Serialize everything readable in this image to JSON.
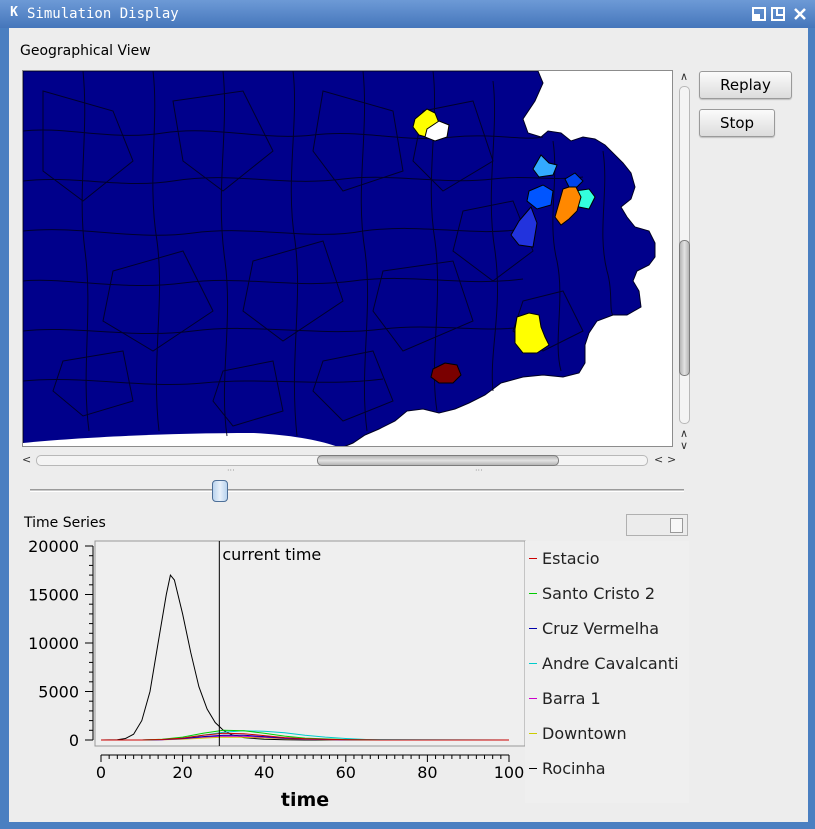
{
  "window": {
    "title": "Simulation Display"
  },
  "geo": {
    "label": "Geographical View",
    "ocean_color": "#ffffff",
    "land_color": "#00008b",
    "highlight_colors": [
      "#ffff00",
      "#ffff00",
      "#33aaff",
      "#0055ff",
      "#2233dd",
      "#33ffdd",
      "#ff8800",
      "#7a0000",
      "#ffffff"
    ]
  },
  "buttons": {
    "replay": "Replay",
    "stop": "Stop"
  },
  "timeline": {
    "value_fraction": 0.28
  },
  "timeseries": {
    "label": "Time Series",
    "marker_label": "current time"
  },
  "chart_data": {
    "type": "line",
    "xlabel": "time",
    "ylabel": "",
    "xlim": [
      0,
      100
    ],
    "ylim": [
      0,
      20000
    ],
    "x_ticks": [
      "0",
      "20",
      "40",
      "60",
      "80",
      "100"
    ],
    "y_ticks": [
      "0",
      "5000",
      "10000",
      "15000",
      "20000"
    ],
    "current_time": 29,
    "legend_placement": "right",
    "series": [
      {
        "name": "Estacio",
        "color": "#cc0000",
        "x": [
          0,
          10,
          15,
          20,
          25,
          30,
          35,
          40,
          45,
          50,
          60,
          70,
          100
        ],
        "y": [
          0,
          0,
          50,
          200,
          500,
          700,
          650,
          450,
          250,
          120,
          20,
          0,
          0
        ]
      },
      {
        "name": "Santo Cristo 2",
        "color": "#00cc00",
        "x": [
          0,
          10,
          15,
          20,
          25,
          30,
          35,
          40,
          45,
          50,
          60,
          70,
          100
        ],
        "y": [
          0,
          0,
          80,
          300,
          700,
          1000,
          950,
          700,
          400,
          200,
          40,
          0,
          0
        ]
      },
      {
        "name": "Cruz Vermelha",
        "color": "#0000aa",
        "x": [
          0,
          10,
          15,
          20,
          25,
          30,
          35,
          40,
          45,
          50,
          60,
          70,
          100
        ],
        "y": [
          0,
          0,
          40,
          150,
          350,
          500,
          480,
          350,
          200,
          100,
          20,
          0,
          0
        ]
      },
      {
        "name": "Andre Cavalcanti",
        "color": "#00cccc",
        "x": [
          0,
          10,
          15,
          20,
          25,
          30,
          35,
          40,
          45,
          50,
          55,
          60,
          65,
          100
        ],
        "y": [
          0,
          0,
          50,
          200,
          500,
          800,
          950,
          900,
          750,
          500,
          300,
          150,
          50,
          0
        ]
      },
      {
        "name": "Barra 1",
        "color": "#cc00cc",
        "x": [
          0,
          10,
          15,
          20,
          25,
          30,
          35,
          40,
          45,
          50,
          60,
          70,
          100
        ],
        "y": [
          0,
          0,
          30,
          120,
          300,
          400,
          380,
          280,
          160,
          80,
          15,
          0,
          0
        ]
      },
      {
        "name": "Downtown",
        "color": "#cccc00",
        "x": [
          0,
          10,
          15,
          20,
          25,
          30,
          35,
          40,
          45,
          50,
          60,
          70,
          100
        ],
        "y": [
          0,
          0,
          20,
          80,
          200,
          300,
          290,
          220,
          130,
          60,
          10,
          0,
          0
        ]
      },
      {
        "name": "Rocinha",
        "color": "#000000",
        "x": [
          0,
          4,
          6,
          8,
          10,
          12,
          14,
          16,
          17,
          18,
          20,
          22,
          24,
          26,
          28,
          30,
          32,
          35,
          40,
          45,
          50,
          60,
          70,
          100
        ],
        "y": [
          0,
          30,
          150,
          600,
          2000,
          5000,
          10000,
          15000,
          17000,
          16500,
          13000,
          9000,
          5500,
          3200,
          1800,
          1000,
          550,
          250,
          70,
          20,
          5,
          0,
          0,
          0
        ]
      }
    ]
  }
}
